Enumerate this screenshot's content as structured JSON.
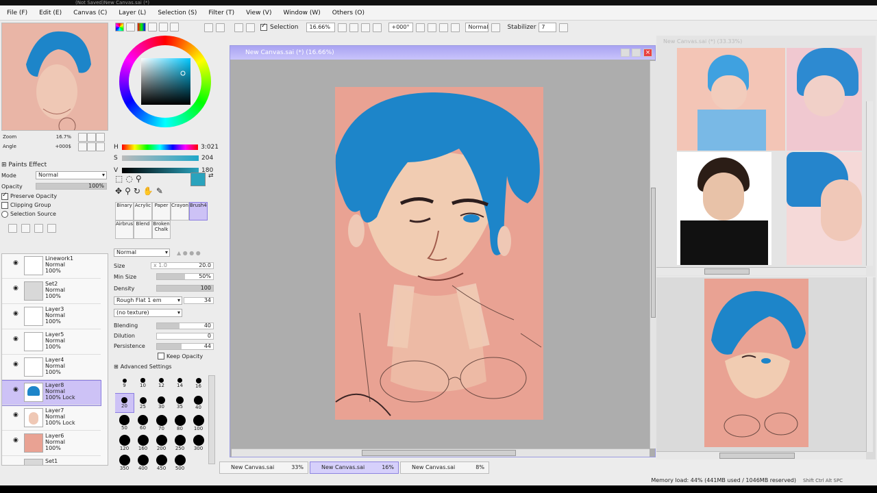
{
  "title": "(Not Saved)New Canvas.sai (*)",
  "menu": [
    "File (F)",
    "Edit (E)",
    "Canvas (C)",
    "Layer (L)",
    "Selection (S)",
    "Filter (T)",
    "View (V)",
    "Window (W)",
    "Others (O)"
  ],
  "toolbar": {
    "selection_label": "Selection",
    "zoom": "16.66%",
    "rotation": "+000°",
    "blend_mode": "Normal",
    "stabilizer_label": "Stabilizer",
    "stabilizer_value": "7"
  },
  "navigator": {
    "zoom_label": "Zoom",
    "zoom_value": "16.7%",
    "angle_label": "Angle",
    "angle_value": "+000$"
  },
  "color_panel": {
    "h_label": "H",
    "h_value": "3:021",
    "s_label": "S",
    "s_value": "204",
    "v_label": "V",
    "v_value": "180",
    "current_color": "#2aa3bd",
    "ring_hex": "#1f8fd9"
  },
  "paint_effect": {
    "header": "Paints Effect",
    "mode_label": "Mode",
    "mode_value": "Normal",
    "opacity_label": "Opacity",
    "opacity_value": "100%",
    "opacity_level": 1.0,
    "preserve_opacity": "Preserve Opacity",
    "clipping_group": "Clipping Group",
    "selection_source": "Selection Source"
  },
  "layers": [
    {
      "name": "Linework1",
      "mode": "Normal",
      "opacity": "100%",
      "kind": "white"
    },
    {
      "name": "Set2",
      "mode": "Normal",
      "opacity": "100%",
      "kind": "folder"
    },
    {
      "name": "Layer3",
      "mode": "Normal",
      "opacity": "100%",
      "kind": "white"
    },
    {
      "name": "Layer5",
      "mode": "Normal",
      "opacity": "100%",
      "kind": "white"
    },
    {
      "name": "Layer4",
      "mode": "Normal",
      "opacity": "100%",
      "kind": "white"
    },
    {
      "name": "Layer8",
      "mode": "Normal",
      "opacity": "100% Lock",
      "kind": "hair",
      "active": true
    },
    {
      "name": "Layer7",
      "mode": "Normal",
      "opacity": "100% Lock",
      "kind": "skin"
    },
    {
      "name": "Layer6",
      "mode": "Normal",
      "opacity": "100%",
      "kind": "pink"
    },
    {
      "name": "Set1",
      "mode": "",
      "opacity": "",
      "kind": "folder"
    }
  ],
  "brush_tools": {
    "row1": [
      "Binary",
      "Acrylic",
      "Paper",
      "Crayon"
    ],
    "row2": [
      "Brush4C",
      "Airbrush",
      "Blend",
      "Broken Chalk"
    ]
  },
  "brush": {
    "mode": "Normal",
    "size_label": "Size",
    "size_mult": "x 1.0",
    "size_value": "20.0",
    "min_size_label": "Min Size",
    "min_size_value": "50%",
    "min_size_level": 0.5,
    "density_label": "Density",
    "density_value": "100",
    "density_level": 1.0,
    "shape": "Rough Flat 1 em",
    "shape_value": "34",
    "texture": "(no texture)",
    "blending_label": "Blending",
    "blending_value": "40",
    "blending_level": 0.4,
    "dilution_label": "Dilution",
    "dilution_value": "0",
    "dilution_level": 0,
    "persistence_label": "Persistence",
    "persistence_value": "44",
    "persistence_level": 0.44,
    "keep_opacity": "Keep Opacity",
    "advanced": "Advanced Settings"
  },
  "brush_sizes": [
    "9",
    "10",
    "12",
    "14",
    "16",
    "20",
    "25",
    "30",
    "35",
    "40",
    "50",
    "60",
    "70",
    "80",
    "100",
    "120",
    "160",
    "200",
    "250",
    "300",
    "350",
    "400",
    "450",
    "500"
  ],
  "canvas_window": {
    "title": "New Canvas.sai (*) (16.66%)"
  },
  "ref_window_title": "New Canvas.sai (*) (33.33%)",
  "tabs": [
    {
      "label": "New Canvas.sai",
      "pct": "33%",
      "active": false
    },
    {
      "label": "New Canvas.sai",
      "pct": "16%",
      "active": true
    },
    {
      "label": "New Canvas.sai",
      "pct": "8%",
      "active": false
    }
  ],
  "status": {
    "memory": "Memory load: 44% (441MB used / 1046MB reserved)",
    "keys": "Shift Ctrl Alt SPC"
  },
  "colors": {
    "skin_bg": "#e9a293",
    "hair": "#1d85c9",
    "accent": "#9a9ae0"
  }
}
